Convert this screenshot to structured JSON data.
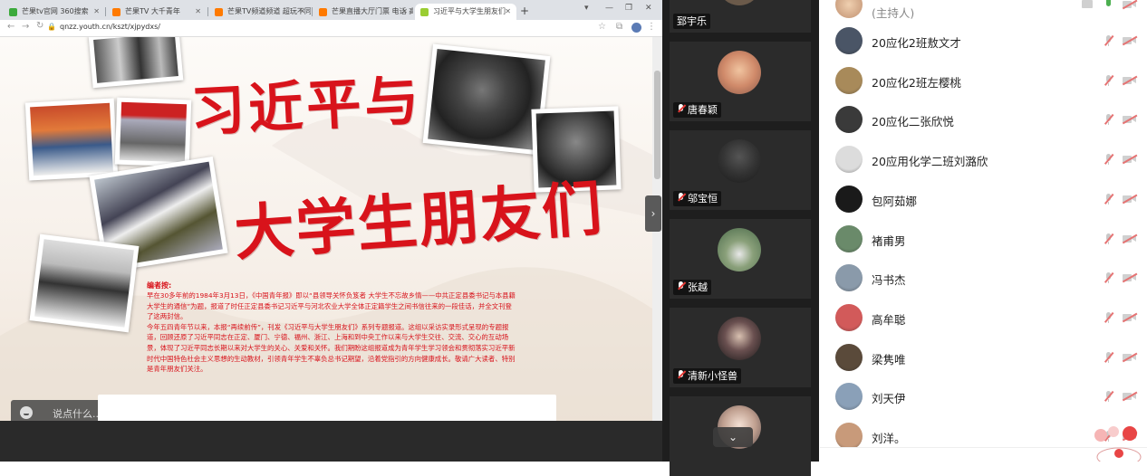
{
  "browser": {
    "tabs": [
      {
        "label": "芒果tv官网 360搜索",
        "color": "#3caa3c"
      },
      {
        "label": "芒果TV 大千青年",
        "color": "#ff7a00"
      },
      {
        "label": "芒果TV频道频道 超玩不同人",
        "color": "#ff7a00"
      },
      {
        "label": "芒果直播大厅门票 电话 高清线",
        "color": "#ff7a00"
      },
      {
        "label": "习近平与大学生朋友们",
        "color": "#9acd32"
      }
    ],
    "url": "qnzz.youth.cn/kszt/xjpydxs/"
  },
  "page": {
    "title_line1": "习近平与",
    "title_line2": "大学生朋友们",
    "note_head": "编者按:",
    "note_p1": "早在30多年前的1984年3月13日，《中国青年报》即以“县领导关怀负笈者 大学生不忘故乡情——中共正定县委书记与本县籍大学生的通信”为题，报道了时任正定县委书记习近平与河北农业大学全体正定籍学生之间书信往来的一段佳话，并全文刊登了这两封信。",
    "note_p2": "今年五四青年节以来，本报“再续前传”，刊发《习近平与大学生朋友们》系列专题报道。这组以采访实录形式呈现的专题报道，回顾还原了习近平同志在正定、厦门、宁德、福州、浙江、上海和到中央工作以来与大学生交往、交流、交心的互动场景，体现了习近平同志长期以来对大学生的关心、关爱和关怀。我们期盼这组报道成为青年学生学习领会和贯彻落实习近平新时代中国特色社会主义思想的生动教材，引领青年学生不辜负总书记期望，沿着党指引的方向健康成长。敬请广大读者、特别是青年朋友们关注。",
    "chat_placeholder": "说点什么...",
    "chat_arrow": "‹",
    "collapse_arrow": "›"
  },
  "video_tiles": [
    {
      "name": "郅宇乐",
      "muted": false,
      "avatar_color": "#6b5a4a"
    },
    {
      "name": "唐春颖",
      "muted": true,
      "avatar_color": "#e8b08c"
    },
    {
      "name": "邬宝恒",
      "muted": true,
      "avatar_color": "#3a3a3a"
    },
    {
      "name": "张越",
      "muted": true,
      "avatar_color": "#6c8a5e"
    },
    {
      "name": "清新小怪兽",
      "muted": true,
      "avatar_color": "#2e2b2b"
    },
    {
      "name": "",
      "muted": true,
      "avatar_color": "#cfcfcf"
    }
  ],
  "scroll_down": "⌄",
  "members": {
    "host_label": "(主持人)",
    "list": [
      {
        "name": "20应化2班敖文才",
        "avatar_color": "#4a5566"
      },
      {
        "name": "20应化2班左樱桃",
        "avatar_color": "#a88a5a"
      },
      {
        "name": "20应化二张欣悦",
        "avatar_color": "#3a3a3a"
      },
      {
        "name": "20应用化学二班刘潞欣",
        "avatar_color": "#dcdcdc"
      },
      {
        "name": "包阿茹娜",
        "avatar_color": "#1a1a1a"
      },
      {
        "name": "褚甫男",
        "avatar_color": "#6a8a6a"
      },
      {
        "name": "冯书杰",
        "avatar_color": "#8a9aaa"
      },
      {
        "name": "高牟聪",
        "avatar_color": "#d25a5a"
      },
      {
        "name": "梁隽唯",
        "avatar_color": "#5a4a3a"
      },
      {
        "name": "刘天伊",
        "avatar_color": "#8aa0b8"
      },
      {
        "name": "刘洋。",
        "avatar_color": "#c89a7a"
      }
    ]
  },
  "colors": {
    "accent_red": "#d8131b",
    "muted_red": "#e57373"
  }
}
